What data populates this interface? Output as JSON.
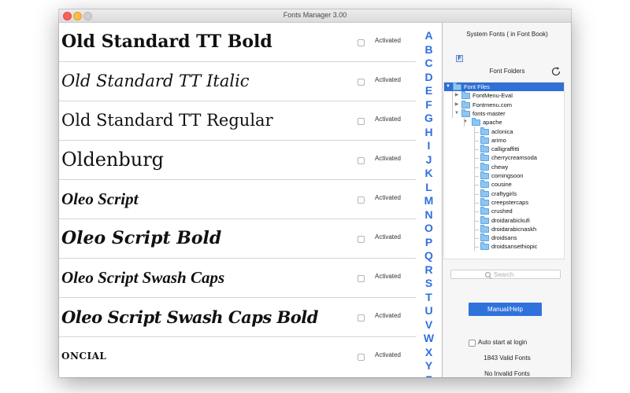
{
  "window": {
    "title": "Fonts Manager 3.00"
  },
  "fonts": [
    {
      "name": "Old Standard TT Bold",
      "status": "Activated"
    },
    {
      "name": "Old Standard TT Italic",
      "status": "Activated"
    },
    {
      "name": "Old Standard TT Regular",
      "status": "Activated"
    },
    {
      "name": "Oldenburg",
      "status": "Activated"
    },
    {
      "name": "Oleo Script",
      "status": "Activated"
    },
    {
      "name": "Oleo Script Bold",
      "status": "Activated"
    },
    {
      "name": "Oleo Script Swash Caps",
      "status": "Activated"
    },
    {
      "name": "Oleo Script Swash Caps Bold",
      "status": "Activated"
    },
    {
      "name": "Oncial",
      "status": "Activated"
    }
  ],
  "alphabet": [
    "A",
    "B",
    "C",
    "D",
    "E",
    "F",
    "G",
    "H",
    "I",
    "J",
    "K",
    "L",
    "M",
    "N",
    "O",
    "P",
    "Q",
    "R",
    "S",
    "T",
    "U",
    "V",
    "W",
    "X",
    "Y",
    "Z"
  ],
  "right_panel": {
    "system_fonts_label": "System Fonts ( in Font Book)",
    "font_book_icon_glyph": "F",
    "font_folders_label": "Font Folders",
    "tree": [
      {
        "label": "Font Files",
        "level": 0,
        "disclosure": "open",
        "selected": true
      },
      {
        "label": "FontMenu-Eval",
        "level": 1,
        "disclosure": "closed"
      },
      {
        "label": "Fontmenu.com",
        "level": 1,
        "disclosure": "closed"
      },
      {
        "label": "fonts-master",
        "level": 1,
        "disclosure": "open"
      },
      {
        "label": "apache",
        "level": 2,
        "disclosure": "open"
      },
      {
        "label": "aclonica",
        "level": 3
      },
      {
        "label": "arimo",
        "level": 3
      },
      {
        "label": "calligraffitti",
        "level": 3
      },
      {
        "label": "cherrycreamsoda",
        "level": 3
      },
      {
        "label": "chewy",
        "level": 3
      },
      {
        "label": "comingsoon",
        "level": 3
      },
      {
        "label": "cousine",
        "level": 3
      },
      {
        "label": "craftygirls",
        "level": 3
      },
      {
        "label": "creepstercaps",
        "level": 3
      },
      {
        "label": "crushed",
        "level": 3
      },
      {
        "label": "droidarabickufi",
        "level": 3
      },
      {
        "label": "droidarabicnaskh",
        "level": 3
      },
      {
        "label": "droidsans",
        "level": 3
      },
      {
        "label": "droidsansethiopic",
        "level": 3
      }
    ],
    "search_placeholder": "Search",
    "manual_button": "Manual/Help",
    "auto_start_label": "Auto start at login",
    "valid_fonts": "1843 Valid Fonts",
    "invalid_fonts": "No Invalid Fonts"
  },
  "colors": {
    "accent": "#2f72db",
    "alphabet": "#2f6fe0",
    "selection": "#2f6fd6"
  }
}
